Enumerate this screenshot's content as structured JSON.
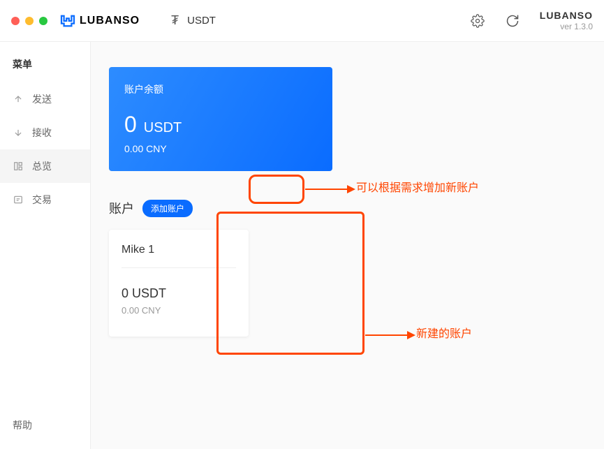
{
  "app": {
    "name": "LUBANSO",
    "version_name": "LUBANSO",
    "version": "ver 1.3.0"
  },
  "currency": {
    "symbol": "USDT"
  },
  "sidebar": {
    "menu_title": "菜单",
    "items": [
      {
        "label": "发送"
      },
      {
        "label": "接收"
      },
      {
        "label": "总览"
      },
      {
        "label": "交易"
      }
    ],
    "help": "帮助"
  },
  "balance": {
    "label": "账户余额",
    "amount": "0",
    "unit": "USDT",
    "fiat": "0.00 CNY"
  },
  "accounts": {
    "title": "账户",
    "add_btn": "添加账户",
    "list": [
      {
        "name": "Mike 1",
        "balance": "0 USDT",
        "fiat": "0.00 CNY"
      }
    ]
  },
  "annotations": {
    "add_hint": "可以根据需求增加新账户",
    "new_hint": "新建的账户"
  }
}
